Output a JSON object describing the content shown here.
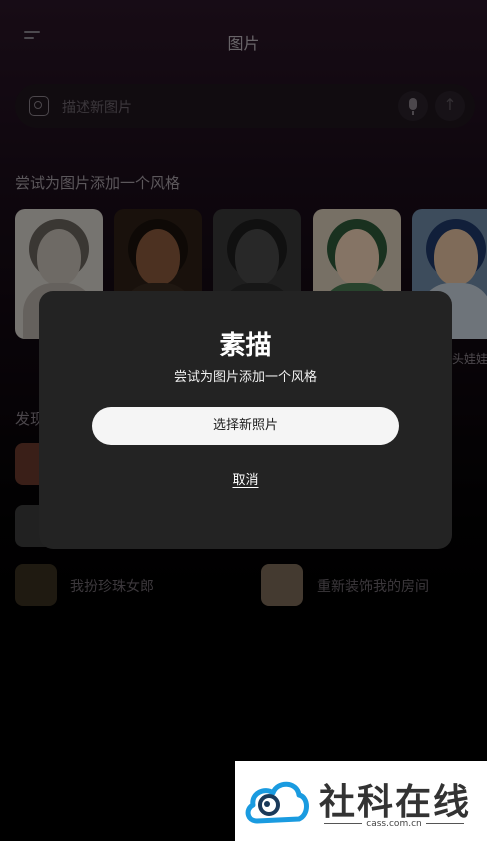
{
  "header": {
    "title": "图片"
  },
  "search": {
    "placeholder": "描述新图片"
  },
  "style_section": {
    "title": "尝试为图片添加一个风格",
    "partial_label": "头娃娃"
  },
  "discover": {
    "title": "发现",
    "items": [
      {
        "label": "我扮珍珠女郎"
      },
      {
        "label": "重新装饰我的房间"
      }
    ]
  },
  "modal": {
    "title": "素描",
    "subtitle": "尝试为图片添加一个风格",
    "primary_button": "选择新照片",
    "cancel_button": "取消"
  },
  "watermark": {
    "title": "社科在线",
    "url": "cass.com.cn"
  },
  "colors": {
    "modal_bg": "#232323",
    "primary_button_bg": "#f5f5f5",
    "watermark_blue": "#1a9be0"
  }
}
